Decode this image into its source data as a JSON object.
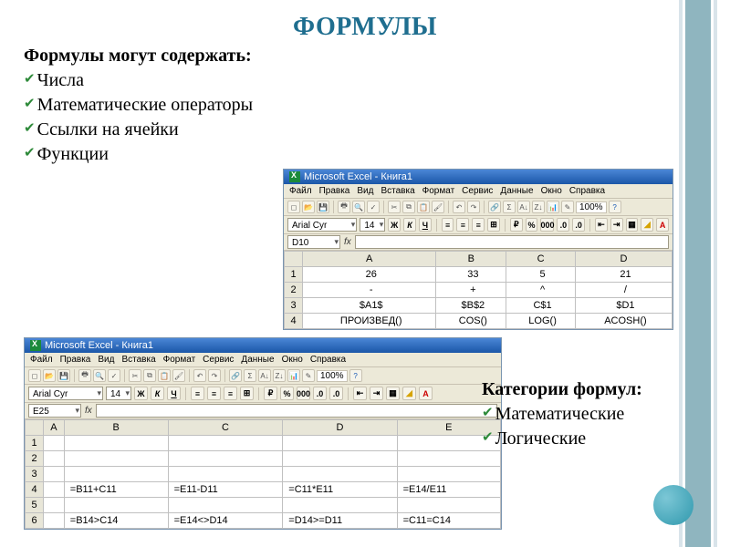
{
  "title": "ФОРМУЛЫ",
  "subtitle1": "Формулы могут содержать:",
  "bullets1": [
    "Числа",
    "Математические операторы",
    "Ссылки на ячейки",
    "Функции"
  ],
  "excel": {
    "window_title": "Microsoft Excel - Книга1",
    "menus": [
      "Файл",
      "Правка",
      "Вид",
      "Вставка",
      "Формат",
      "Сервис",
      "Данные",
      "Окно",
      "Справка"
    ],
    "font_name": "Arial Cyr",
    "font_size": "14",
    "zoom": "100%",
    "fx_label": "fx",
    "col_headers": [
      "A",
      "B",
      "C",
      "D"
    ],
    "col_headers2": [
      "A",
      "B",
      "C",
      "D",
      "E"
    ],
    "w1": {
      "namebox": "D10",
      "rows": [
        [
          "26",
          "33",
          "5",
          "21"
        ],
        [
          "-",
          "+",
          "^",
          "/"
        ],
        [
          "$A1$",
          "$B$2",
          "C$1",
          "$D1"
        ],
        [
          "ПРОИЗВЕД()",
          "COS()",
          "LOG()",
          "ACOSH()"
        ]
      ]
    },
    "w2": {
      "namebox": "E25",
      "rows": [
        [
          "",
          "",
          "",
          "",
          ""
        ],
        [
          "",
          "",
          "",
          "",
          ""
        ],
        [
          "",
          "",
          "",
          "",
          ""
        ],
        [
          "",
          "=B11+C11",
          "=E11-D11",
          "=C11*E11",
          "=E14/E11"
        ],
        [
          "",
          "",
          "",
          "",
          ""
        ],
        [
          "",
          "=B14>C14",
          "=E14<>D14",
          "=D14>=D11",
          "=C11=C14"
        ]
      ]
    }
  },
  "subtitle2": "Категории формул:",
  "bullets2": [
    "Математические",
    "Логические"
  ]
}
